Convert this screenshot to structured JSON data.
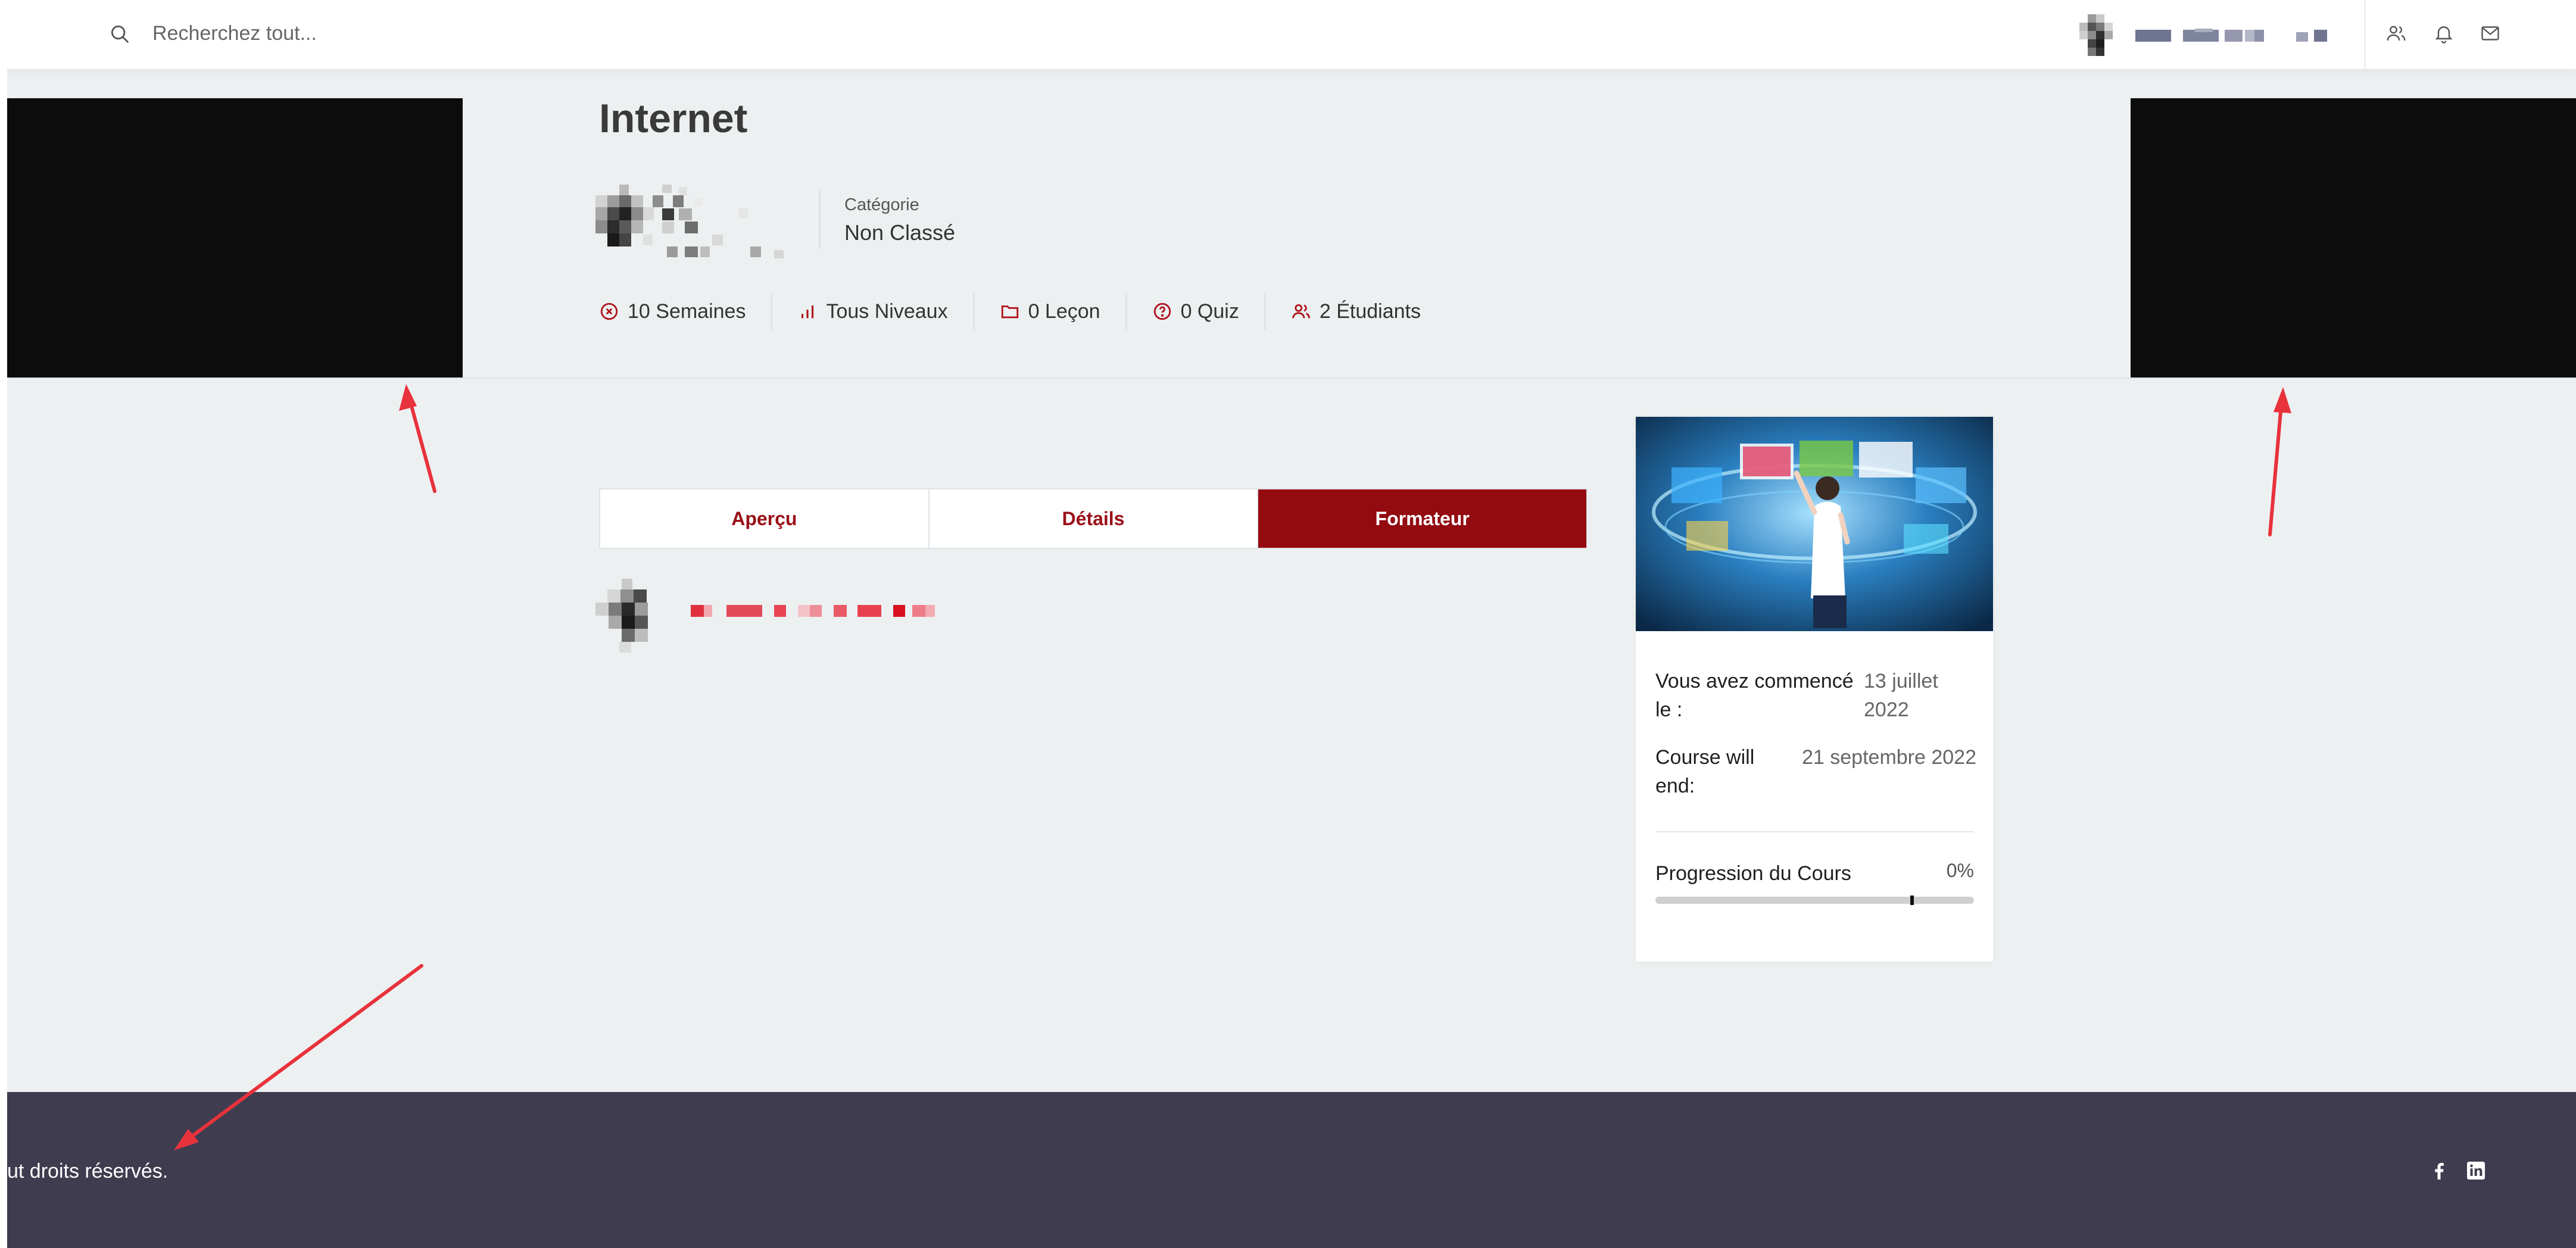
{
  "header": {
    "search_placeholder": "Recherchez tout...",
    "icons": [
      "search-icon",
      "users-icon",
      "bell-icon",
      "mail-icon"
    ]
  },
  "course": {
    "title": "Internet",
    "category_label": "Catégorie",
    "category_value": "Non Classé",
    "stats": {
      "duration": "10 Semaines",
      "level": "Tous Niveaux",
      "lessons": "0 Leçon",
      "quizzes": "0 Quiz",
      "students": "2 Étudiants"
    }
  },
  "tabs": {
    "overview": "Aperçu",
    "details": "Détails",
    "instructor": "Formateur",
    "active": "Formateur"
  },
  "sidebar_card": {
    "started_label": "Vous avez commencé le :",
    "started_value": "13 juillet 2022",
    "end_label": "Course will end:",
    "end_value": "21 septembre 2022",
    "progress_label": "Progression du Cours",
    "progress_text": "0%",
    "progress_value": 0
  },
  "footer": {
    "copyright": "ut droits réservés.",
    "social": [
      "facebook-icon",
      "linkedin-icon"
    ]
  },
  "colors": {
    "accent": "#930b11",
    "footer_bg": "#3f3c4f",
    "page_bg": "#edf0f1",
    "annotation": "#e8323c"
  }
}
